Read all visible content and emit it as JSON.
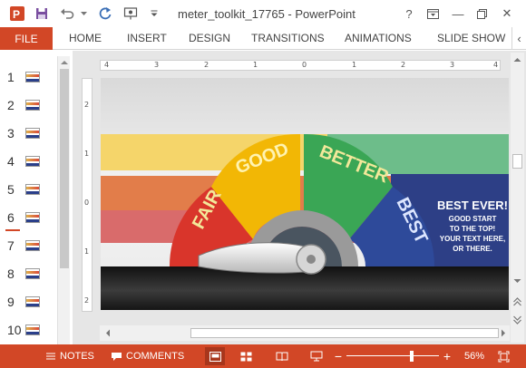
{
  "titlebar": {
    "title": "meter_toolkit_17765 - PowerPoint",
    "icons": [
      "powerpoint-logo",
      "save",
      "undo",
      "redo",
      "present-from-start",
      "customize"
    ],
    "help": "?",
    "win_restore_label": "restore",
    "minimize": "—",
    "close": "✕"
  },
  "ribbon": {
    "file": "FILE",
    "tabs": [
      "HOME",
      "INSERT",
      "DESIGN",
      "TRANSITIONS",
      "ANIMATIONS",
      "SLIDE SHOW"
    ],
    "overflow_glyph": "‹"
  },
  "thumbnails": [
    {
      "num": "1"
    },
    {
      "num": "2"
    },
    {
      "num": "3"
    },
    {
      "num": "4"
    },
    {
      "num": "5"
    },
    {
      "num": "6"
    },
    {
      "num": "7"
    },
    {
      "num": "8"
    },
    {
      "num": "9"
    },
    {
      "num": "10"
    }
  ],
  "ruler": {
    "horizontal": [
      "4",
      "3",
      "2",
      "1",
      "0",
      "1",
      "2",
      "3",
      "4"
    ],
    "vertical": [
      "2",
      "1",
      "0",
      "1",
      "2"
    ]
  },
  "slide": {
    "segments": [
      "FAIR",
      "GOOD",
      "BETTER",
      "BEST"
    ],
    "headline": "BEST EVER!",
    "body": [
      "GOOD START",
      "TO THE TOP!",
      "YOUR TEXT HERE,",
      "OR THERE."
    ],
    "colors": {
      "fair": "#d9352b",
      "good": "#f2b705",
      "better": "#3aa655",
      "best": "#2e4a9a",
      "band_yellow": "#f5d56a",
      "band_orange": "#e27d4a",
      "band_red": "#d96b6b",
      "band_green": "#6dbd8a",
      "band_blue": "#2d3f86"
    },
    "needle_level": 0.05
  },
  "status": {
    "notes": "NOTES",
    "comments": "COMMENTS",
    "zoom": "56%",
    "zoom_fraction": 0.56,
    "colors": {
      "bar": "#d24726"
    }
  }
}
